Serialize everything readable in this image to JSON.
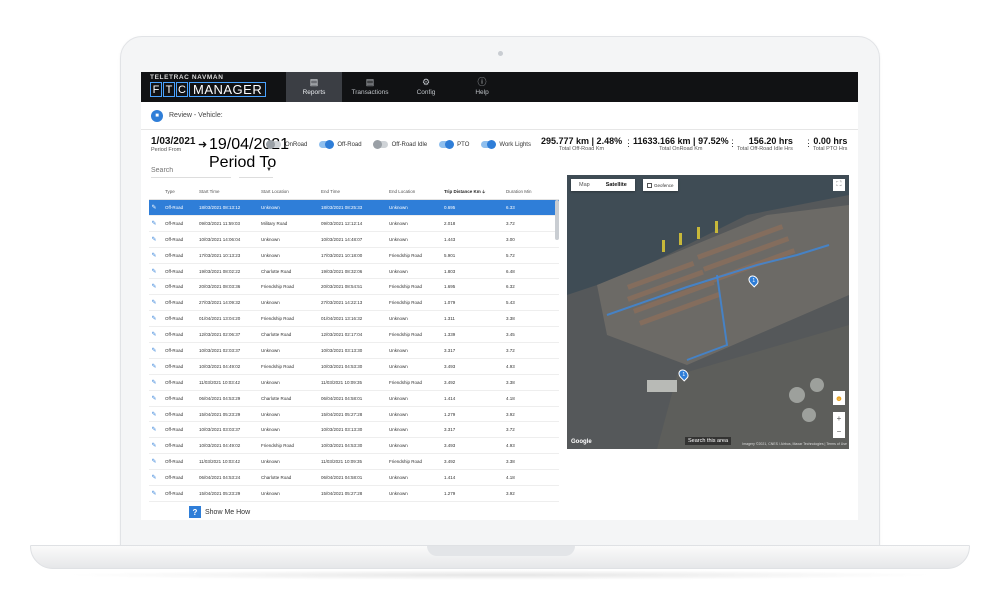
{
  "header": {
    "brand_top": "TELETRAC NAVMAN",
    "brand_letters": [
      "F",
      "T",
      "C"
    ],
    "brand_main": "MANAGER",
    "nav": [
      {
        "label": "Reports",
        "icon": "document-icon",
        "active": true
      },
      {
        "label": "Transactions",
        "icon": "receipt-icon",
        "active": false
      },
      {
        "label": "Config",
        "icon": "gear-icon",
        "active": false
      },
      {
        "label": "Help",
        "icon": "question-icon",
        "active": false
      }
    ]
  },
  "subheader": {
    "title": "Review - Vehicle:"
  },
  "period": {
    "from_date": "1/03/2021",
    "from_label": "Period From",
    "to_date": "19/04/2021",
    "to_label": "Period To"
  },
  "toggles": [
    {
      "label": "OnRoad",
      "on": false
    },
    {
      "label": "Off-Road",
      "on": true
    },
    {
      "label": "Off-Road Idle",
      "on": false
    },
    {
      "label": "PTO",
      "on": true
    },
    {
      "label": "Work Lights",
      "on": true
    }
  ],
  "stats": [
    {
      "value": "295.777 km | 2.48%",
      "label": "Total Off-Road Km"
    },
    {
      "value": "11633.166 km | 97.52%",
      "label": "Total OnRoad Km"
    },
    {
      "value": "156.20 hrs",
      "label": "Total Off-Road Idle Hrs"
    },
    {
      "value": "0.00 hrs",
      "label": "Total PTO Hrs"
    }
  ],
  "search": {
    "placeholder": "Search"
  },
  "table": {
    "columns": [
      "Type",
      "Start Time",
      "Start Location",
      "End Time",
      "End Location",
      "Trip Distance Km",
      "Duration Min"
    ],
    "rows": [
      [
        "Off-Road",
        "18/03/2021 08:13:12",
        "Unknown",
        "18/03/2021 08:25:33",
        "Unknown",
        "0.695",
        "6.33"
      ],
      [
        "Off-Road",
        "09/03/2021 11:59:03",
        "Military Road",
        "09/03/2021 12:12:14",
        "Unknown",
        "2.018",
        "3.72"
      ],
      [
        "Off-Road",
        "10/03/2021 14:06:04",
        "Unknown",
        "10/03/2021 14:48:07",
        "Unknown",
        "1.443",
        "3.00"
      ],
      [
        "Off-Road",
        "17/03/2021 10:13:23",
        "Unknown",
        "17/03/2021 10:18:00",
        "Friendship Road",
        "5.901",
        "5.72"
      ],
      [
        "Off-Road",
        "19/03/2021 08:02:22",
        "Charlotte Road",
        "19/03/2021 08:32:06",
        "Unknown",
        "1.803",
        "6.48"
      ],
      [
        "Off-Road",
        "20/03/2021 08:03:36",
        "Friendship Road",
        "20/03/2021 08:54:51",
        "Friendship Road",
        "1.695",
        "6.32"
      ],
      [
        "Off-Road",
        "27/03/2021 14:09:32",
        "Unknown",
        "27/03/2021 14:22:13",
        "Friendship Road",
        "1.079",
        "5.43"
      ],
      [
        "Off-Road",
        "01/04/2021 13:04:20",
        "Friendship Road",
        "01/04/2021 13:16:32",
        "Unknown",
        "1.311",
        "3.38"
      ],
      [
        "Off-Road",
        "12/03/2021 02:06:37",
        "Charlotte Road",
        "12/03/2021 02:17:04",
        "Friendship Road",
        "1.339",
        "3.45"
      ],
      [
        "Off-Road",
        "10/03/2021 02:03:37",
        "Unknown",
        "10/03/2021 03:13:30",
        "Unknown",
        "3.317",
        "3.72"
      ],
      [
        "Off-Road",
        "10/03/2021 04:49:02",
        "Friendship Road",
        "10/03/2021 04:53:30",
        "Unknown",
        "3.493",
        "4.93"
      ],
      [
        "Off-Road",
        "11/03/2021 10:03:42",
        "Unknown",
        "11/03/2021 10:09:35",
        "Friendship Road",
        "3.492",
        "3.38"
      ],
      [
        "Off-Road",
        "06/04/2021 04:53:29",
        "Charlotte Road",
        "06/04/2021 04:58:01",
        "Unknown",
        "1.414",
        "4.18"
      ],
      [
        "Off-Road",
        "15/04/2021 05:23:29",
        "Unknown",
        "15/04/2021 05:27:28",
        "Unknown",
        "1.279",
        "3.92"
      ],
      [
        "Off-Road",
        "10/03/2021 03:03:37",
        "Unknown",
        "10/03/2021 03:13:30",
        "Unknown",
        "3.317",
        "3.72"
      ],
      [
        "Off-Road",
        "10/03/2021 04:49:02",
        "Friendship Road",
        "10/03/2021 04:53:30",
        "Unknown",
        "3.493",
        "4.93"
      ],
      [
        "Off-Road",
        "11/03/2021 10:03:42",
        "Unknown",
        "11/03/2021 10:09:35",
        "Friendship Road",
        "3.492",
        "3.38"
      ],
      [
        "Off-Road",
        "06/04/2021 04:53:24",
        "Charlotte Road",
        "06/04/2021 04:58:01",
        "Unknown",
        "1.414",
        "4.18"
      ],
      [
        "Off-Road",
        "15/04/2021 05:23:29",
        "Unknown",
        "15/04/2021 05:27:28",
        "Unknown",
        "1.279",
        "3.92"
      ]
    ]
  },
  "help": {
    "label": "Show Me How"
  },
  "map": {
    "tabs": [
      {
        "label": "Map",
        "active": false
      },
      {
        "label": "Satellite",
        "active": true
      }
    ],
    "geofence_label": "Geofence",
    "search_area": "Search this area",
    "google": "Google",
    "attribution": "Imagery ©2021, CNES / Airbus, Maxar Technologies | Terms of Use",
    "pins": [
      "1",
      "1"
    ]
  },
  "colors": {
    "accent": "#2f7ed8",
    "topbar": "#111214",
    "active_nav": "#3b3e44"
  }
}
